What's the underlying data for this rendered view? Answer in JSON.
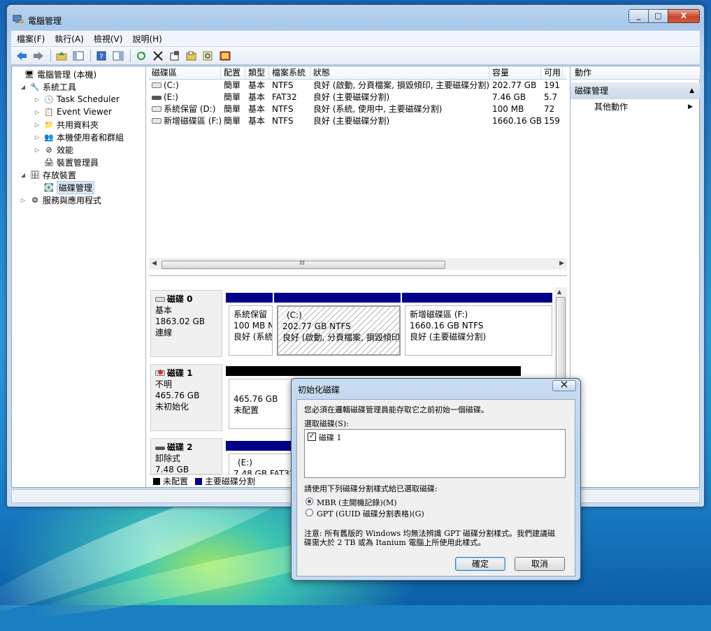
{
  "window": {
    "title": "電腦管理",
    "controls": {
      "minimize": "_",
      "maximize": "□",
      "close": "X"
    }
  },
  "menu": [
    "檔案(F)",
    "執行(A)",
    "檢視(V)",
    "說明(H)"
  ],
  "toolbar": [
    "back-icon",
    "forward-icon",
    "up-folder-icon",
    "show-hide-tree-icon",
    "help-icon",
    "properties-pane-icon",
    "refresh-icon",
    "delete-icon",
    "properties-icon",
    "open-icon",
    "search-icon",
    "console-icon"
  ],
  "tree": [
    {
      "label": "電腦管理 (本機)",
      "level": 0,
      "expander": ""
    },
    {
      "label": "系統工具",
      "level": 1,
      "expander": "◢"
    },
    {
      "label": "Task Scheduler",
      "level": 2,
      "expander": "▷"
    },
    {
      "label": "Event Viewer",
      "level": 2,
      "expander": "▷"
    },
    {
      "label": "共用資料夾",
      "level": 2,
      "expander": "▷"
    },
    {
      "label": "本機使用者和群組",
      "level": 2,
      "expander": "▷"
    },
    {
      "label": "效能",
      "level": 2,
      "expander": "▷"
    },
    {
      "label": "裝置管理員",
      "level": 2,
      "expander": ""
    },
    {
      "label": "存放裝置",
      "level": 1,
      "expander": "◢"
    },
    {
      "label": "磁碟管理",
      "level": 2,
      "expander": "",
      "selected": true
    },
    {
      "label": "服務與應用程式",
      "level": 1,
      "expander": "▷"
    }
  ],
  "volume_table": {
    "columns": [
      "磁碟區",
      "配置",
      "類型",
      "檔案系統",
      "狀態",
      "容量",
      "可用"
    ],
    "rows": [
      [
        "(C:)",
        "簡單",
        "基本",
        "NTFS",
        "良好 (啟動, 分頁檔案, 損毀傾印, 主要磁碟分割)",
        "202.77 GB",
        "191"
      ],
      [
        "(E:)",
        "簡單",
        "基本",
        "FAT32",
        "良好 (主要磁碟分割)",
        "7.46 GB",
        "5.7"
      ],
      [
        "系統保留 (D:)",
        "簡單",
        "基本",
        "NTFS",
        "良好 (系統, 使用中, 主要磁碟分割)",
        "100 MB",
        "72"
      ],
      [
        "新增磁碟區 (F:)",
        "簡單",
        "基本",
        "NTFS",
        "良好 (主要磁碟分割)",
        "1660.16 GB",
        "159"
      ]
    ],
    "scroll_grip": "III"
  },
  "disks": {
    "disk0": {
      "name": "磁碟 0",
      "type": "基本",
      "size": "1863.02 GB",
      "status": "連線",
      "partitions": [
        {
          "name": "系統保留",
          "detail": "100 MB N",
          "status": "良好 (系統"
        },
        {
          "name": "(C:)",
          "detail": "202.77 GB NTFS",
          "status": "良好 (啟動, 分頁檔案, 損毀傾印,"
        },
        {
          "name": "新增磁碟區  (F:)",
          "detail": "1660.16 GB NTFS",
          "status": "良好 (主要磁碟分割)"
        }
      ]
    },
    "disk1": {
      "name": "磁碟 1",
      "type": "不明",
      "size": "465.76 GB",
      "status": "未初始化",
      "partition": {
        "size": "465.76 GB",
        "status": "未配置"
      }
    },
    "disk2": {
      "name": "磁碟 2",
      "type": "卸除式",
      "size": "7.48 GB",
      "partition": {
        "name": "(E:)",
        "detail": "7.48 GB FAT32"
      }
    }
  },
  "legend": {
    "unallocated": "未配置",
    "primary": "主要磁碟分割"
  },
  "actions": {
    "header": "動作",
    "section": "磁碟管理",
    "item": "其他動作"
  },
  "dialog": {
    "title": "初始化磁碟",
    "close": "X",
    "intro": "您必須在邏輯磁碟管理員能存取它之前初始一個磁碟。",
    "select_label": "選取磁碟(S):",
    "disk_item": "磁碟 1",
    "style_label": "請使用下列磁碟分割樣式給已選取磁碟:",
    "option_mbr": "MBR (主開機記錄)(M)",
    "option_gpt": "GPT (GUID 磁碟分割表格)(G)",
    "note_line1": "注意: 所有舊版的 Windows 均無法辨識 GPT 磁碟分割樣式。我們建議磁",
    "note_line2": "碟需大於 2 TB 或為 Itanium 電腦上所使用此樣式。",
    "ok": "確定",
    "cancel": "取消"
  },
  "colors": {
    "primary_partition": "#00008b",
    "unallocated": "#000000",
    "accent": "#3399ff"
  }
}
